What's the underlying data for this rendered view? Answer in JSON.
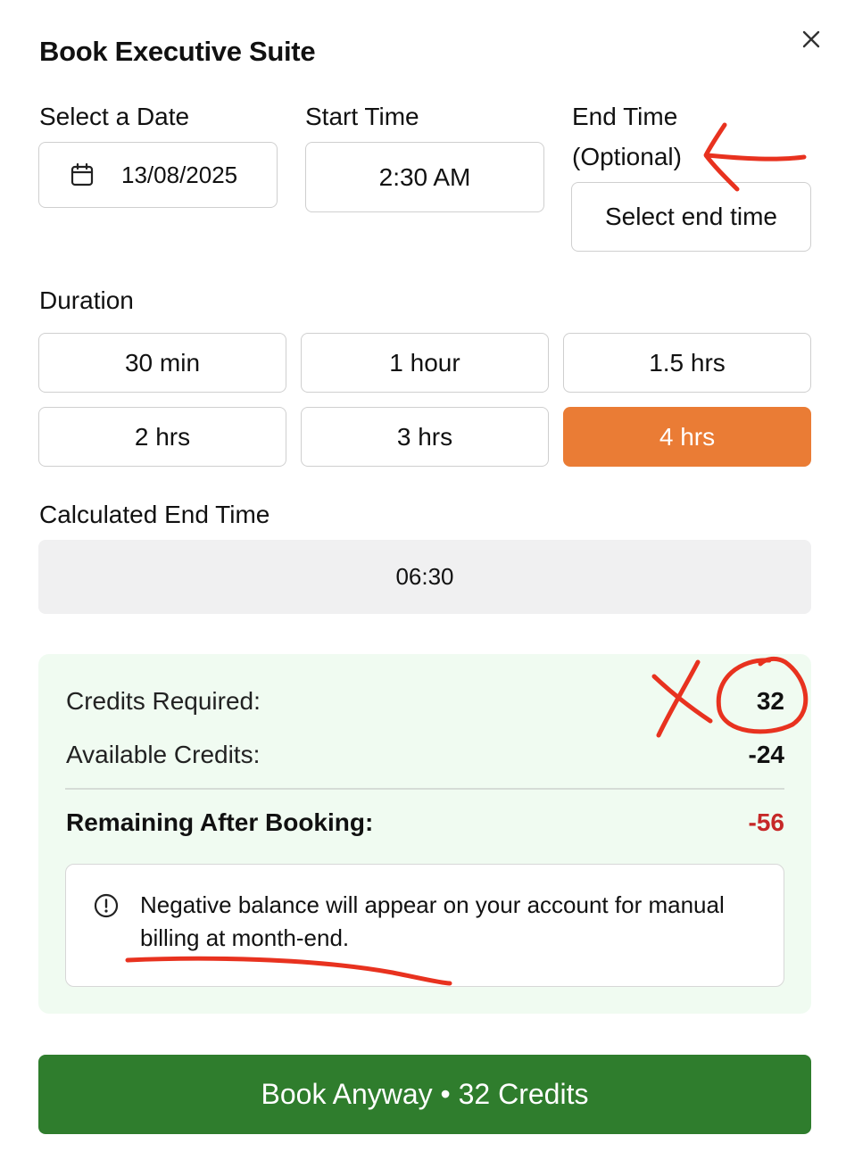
{
  "dialog": {
    "title": "Book Executive Suite",
    "close_icon": "close-icon"
  },
  "date": {
    "label": "Select a Date",
    "value": "13/08/2025",
    "icon": "calendar-icon"
  },
  "start_time": {
    "label": "Start Time",
    "value": "2:30 AM"
  },
  "end_time": {
    "label_line1": "End Time",
    "label_line2": "(Optional)",
    "placeholder": "Select end time"
  },
  "duration": {
    "label": "Duration",
    "options": [
      {
        "label": "30 min",
        "selected": false
      },
      {
        "label": "1 hour",
        "selected": false
      },
      {
        "label": "1.5 hrs",
        "selected": false
      },
      {
        "label": "2 hrs",
        "selected": false
      },
      {
        "label": "3 hrs",
        "selected": false
      },
      {
        "label": "4 hrs",
        "selected": true
      }
    ],
    "selected_color": "#ea7c35"
  },
  "calculated_end": {
    "label": "Calculated End Time",
    "value": "06:30"
  },
  "credits": {
    "required_label": "Credits Required:",
    "required_value": "32",
    "available_label": "Available Credits:",
    "available_value": "-24",
    "remaining_label": "Remaining After Booking:",
    "remaining_value": "-56",
    "remaining_color": "#c62828",
    "panel_color": "#f0fbf1"
  },
  "warning": {
    "icon": "alert-circle-icon",
    "text": "Negative balance will appear on your account for manual billing at month-end."
  },
  "book_button": {
    "label": "Book Anyway • 32 Credits",
    "color": "#2f7d2d"
  },
  "annotations": {
    "ink_color": "#e8321f",
    "marks": [
      "arrow-annotation",
      "x-mark-annotation",
      "circle-annotation",
      "underline-annotation"
    ]
  }
}
